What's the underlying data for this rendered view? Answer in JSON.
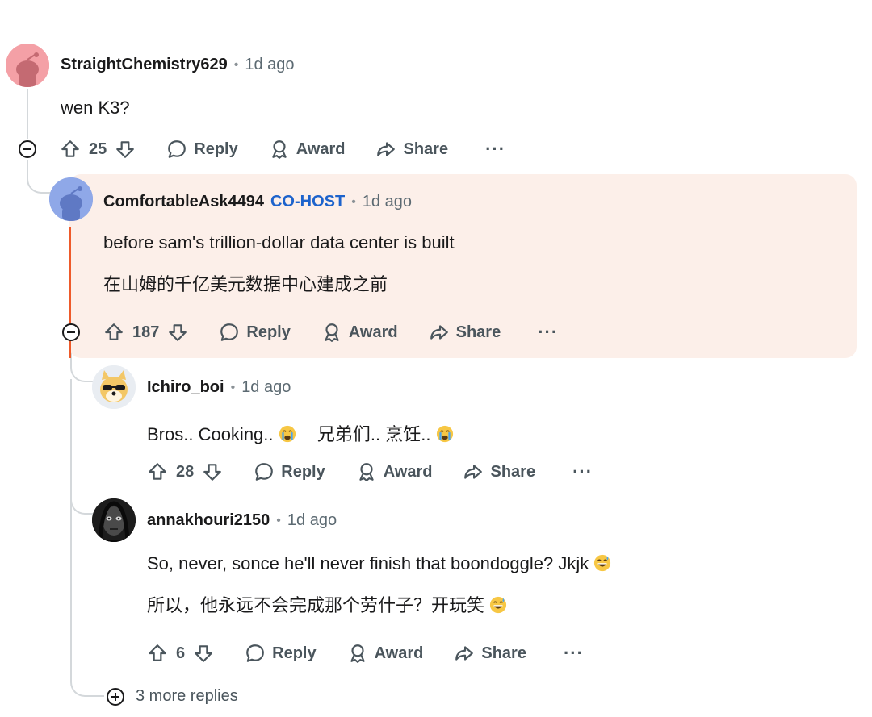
{
  "comments": [
    {
      "author": "StraightChemistry629",
      "time": "1d ago",
      "lines": [
        "wen K3?"
      ],
      "votes": "25",
      "avatar_color": "#f4a0a6"
    },
    {
      "author": "ComfortableAsk4494",
      "role": "CO-HOST",
      "time": "1d ago",
      "lines": [
        "before sam's trillion-dollar data center is built",
        "在山姆的千亿美元数据中心建成之前"
      ],
      "votes": "187",
      "avatar_color": "#8fa8e8"
    },
    {
      "author": "Ichiro_boi",
      "time": "1d ago",
      "lines": [
        "Bros.. Cooking..",
        "兄弟们.. 烹饪.."
      ],
      "votes": "28"
    },
    {
      "author": "annakhouri2150",
      "time": "1d ago",
      "lines": [
        "So, never, sonce he'll never finish that boondoggle? Jkjk",
        "所以，他永远不会完成那个劳什子？开玩笑"
      ],
      "votes": "6"
    }
  ],
  "actions": {
    "reply": "Reply",
    "award": "Award",
    "share": "Share",
    "more": "···"
  },
  "more_replies": "3 more replies",
  "colors": {
    "highlight_bg": "#fcefe9",
    "op_line": "#ee5a2a",
    "co_host": "#1d63cc"
  }
}
